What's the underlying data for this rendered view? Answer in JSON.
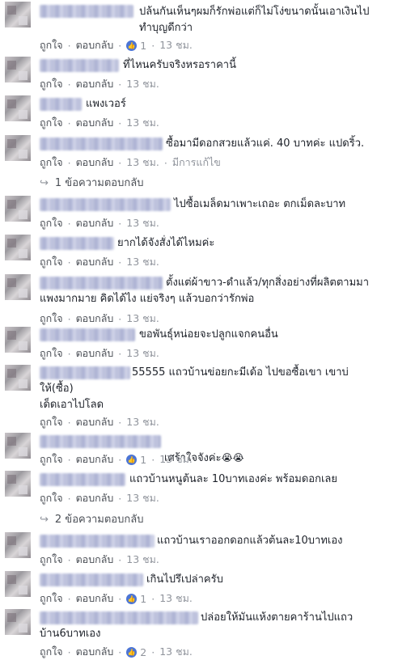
{
  "actions": {
    "like": "ถูกใจ",
    "reply": "ตอบกลับ",
    "sep": "·",
    "edited": "มีการแก้ไข",
    "like_icon": "thumbs-up-icon"
  },
  "comments": [
    {
      "text": "ปล้นกันเห็นๆผมก็รักพ่อแต่ก็ไม่โง่ขนาดนั้นเอาเงินไป\nทำบุญดีกว่า",
      "likes": "1",
      "time": "13 ชม."
    },
    {
      "text": "ที่ไหนครับจริงหรอราคานี้",
      "time": "13 ชม."
    },
    {
      "text": "แพงเวอร์",
      "time": "13 ชม."
    },
    {
      "text": "ซื้อมามีดอกสวยแล้วแค่. 40 บาทค่ะ แปดริ้ว.",
      "time": "13 ชม.",
      "edited": true,
      "replies": "1 ข้อความตอบกลับ"
    },
    {
      "text": "ไปซื้อเมล็ดมาเพาะเถอะ ตกเม็ดละบาท",
      "time": "13 ชม."
    },
    {
      "text": "ยากได้จังสั่งได้ไหมค่ะ",
      "time": "13 ชม."
    },
    {
      "text": "ตั้งแต่ผ้าขาว-ดำแล้ว/ทุกสิ่งอย่างที่ผลิตตามมา\nแพงมากมาย คิดได้ไง แย่จริงๆ แล้วบอกว่ารักพ่อ",
      "time": "13 ชม."
    },
    {
      "text": "ขอพันธุ์หน่อยจะปลูกแจกคนอื่น",
      "time": "13 ชม."
    },
    {
      "text": "55555 แถวบ้านข่อยกะมีเด้อ ไปขอซื้อเขา เขาบ่\nให้(ซื้อ)\nเด็ดเอาไปโลด",
      "time": "13 ชม."
    },
    {
      "text": "เศร้าใจจังค่ะ",
      "emoji": "😭😭",
      "likes": "1",
      "time": "13 ชม."
    },
    {
      "text": "แถวบ้านหนูต้นละ 10บาทเองค่ะ พร้อมดอกเลย",
      "time": "13 ชม.",
      "replies": "2 ข้อความตอบกลับ"
    },
    {
      "text": "แถวบ้านเราออกดอกแล้วต้นละ10บาทเอง",
      "time": "13 ชม."
    },
    {
      "text": "เกินไปรึเปล่าครับ",
      "likes": "1",
      "time": "13 ชม."
    },
    {
      "text": "ปล่อยให้มันแห้งตายคาร้านไปแถว\nบ้าน6บาทเอง",
      "likes": "2",
      "time": "13 ชม."
    }
  ]
}
